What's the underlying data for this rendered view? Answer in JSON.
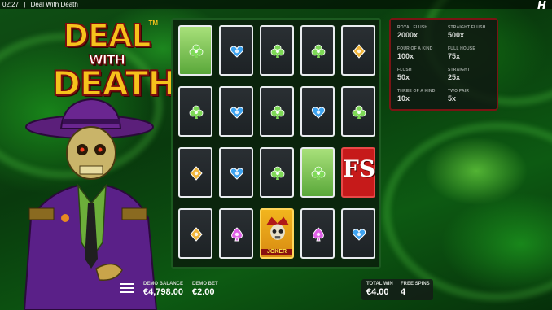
{
  "topbar": {
    "time": "02:27",
    "separator": "|",
    "title": "Deal With Death"
  },
  "brand": {
    "icon": "hacksaw-h-icon",
    "letter": "H"
  },
  "logo": {
    "line1": "DEAL",
    "line2": "WITH",
    "line3": "DEATH",
    "tm": "TM"
  },
  "paytable": [
    {
      "label": "ROYAL FLUSH",
      "value": "2000x"
    },
    {
      "label": "STRAIGHT FLUSH",
      "value": "500x"
    },
    {
      "label": "FOUR OF A KIND",
      "value": "100x"
    },
    {
      "label": "FULL HOUSE",
      "value": "75x"
    },
    {
      "label": "FLUSH",
      "value": "50x"
    },
    {
      "label": "STRAIGHT",
      "value": "25x"
    },
    {
      "label": "THREE OF A KIND",
      "value": "10x"
    },
    {
      "label": "TWO PAIR",
      "value": "5x"
    }
  ],
  "grid": [
    [
      "wild-club",
      "heart",
      "club",
      "club",
      "diamond"
    ],
    [
      "club",
      "heart",
      "club",
      "heart",
      "club"
    ],
    [
      "diamond",
      "heart",
      "club",
      "wild-club",
      "fs"
    ],
    [
      "diamond",
      "spade",
      "joker",
      "spade",
      "heart"
    ]
  ],
  "symbols": {
    "fs_text": "FS",
    "joker_text": "JOKER"
  },
  "colors": {
    "club": "#7ed957",
    "heart": "#3ea3f0",
    "diamond": "#f2b63a",
    "spade": "#e060e8",
    "accent_red": "#c61a1a"
  },
  "bottom": {
    "menu_icon": "hamburger-menu-icon",
    "balance_label": "DEMO BALANCE",
    "balance_value": "€4,798.00",
    "bet_label": "DEMO BET",
    "bet_value": "€2.00",
    "win_label": "TOTAL WIN",
    "win_value": "€4.00",
    "spins_label": "FREE SPINS",
    "spins_value": "4"
  }
}
